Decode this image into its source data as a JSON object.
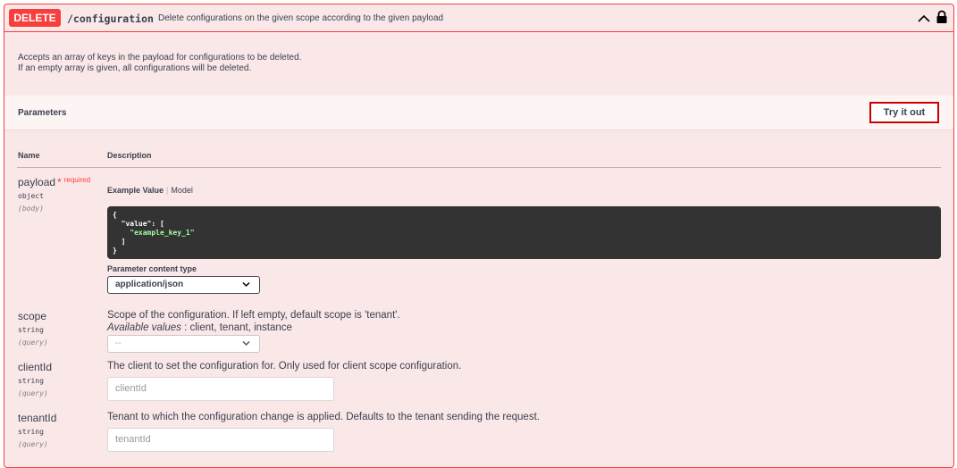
{
  "operation": {
    "method": "DELETE",
    "path": "/configuration",
    "summary": "Delete configurations on the given scope according to the given payload",
    "description_lines": [
      "Accepts an array of keys in the payload for configurations to be deleted.",
      "If an empty array is given, all configurations will be deleted."
    ]
  },
  "parameters": {
    "title": "Parameters",
    "try_button": "Try it out",
    "col_name": "Name",
    "col_description": "Description",
    "payload": {
      "name": "payload",
      "star": "*",
      "required": "required",
      "type": "object",
      "in": "(body)",
      "tab_example": "Example Value",
      "tab_model": "Model",
      "example_open": "{",
      "example_key": "\"value\"",
      "example_after_key": ": [",
      "example_item": "\"example_key_1\"",
      "example_close_arr": "]",
      "example_close": "}",
      "content_type_label": "Parameter content type",
      "content_type_value": "application/json"
    },
    "scope": {
      "name": "scope",
      "type": "string",
      "in": "(query)",
      "description": "Scope of the configuration. If left empty, default scope is 'tenant'.",
      "available_label": "Available values",
      "available_values": " : client, tenant, instance",
      "select_value": "--"
    },
    "clientId": {
      "name": "clientId",
      "type": "string",
      "in": "(query)",
      "description": "The client to set the configuration for. Only used for client scope configuration.",
      "placeholder": "clientId"
    },
    "tenantId": {
      "name": "tenantId",
      "type": "string",
      "in": "(query)",
      "description": "Tenant to which the configuration change is applied. Defaults to the tenant sending the request.",
      "placeholder": "tenantId"
    }
  },
  "colors": {
    "delete": "#f93e3e",
    "block_bg": "#fae7e7",
    "code_bg": "#333333",
    "code_string": "#a2fca2"
  }
}
